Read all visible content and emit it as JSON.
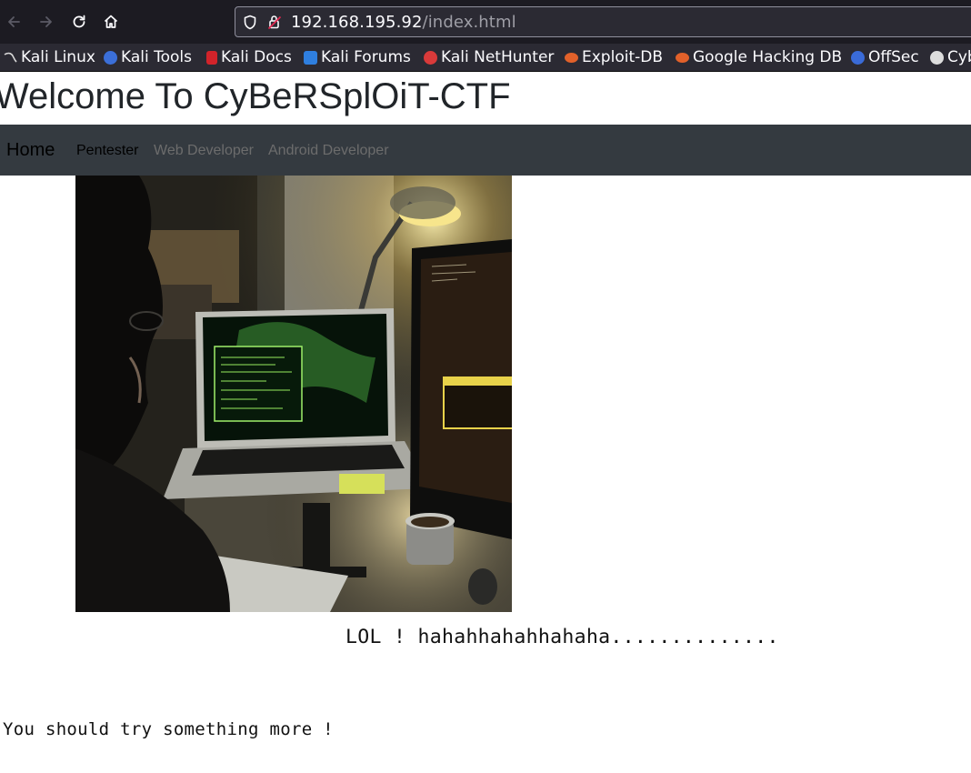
{
  "browser": {
    "url_host": "192.168.195.92",
    "url_path": "/index.html",
    "icons": [
      "back-arrow-icon",
      "forward-arrow-icon",
      "reload-icon",
      "home-icon",
      "shield-icon",
      "insecure-lock-icon"
    ]
  },
  "bookmarks": [
    {
      "label": "Kali Linux",
      "icon": "kali-dragon-icon",
      "color": "#111111"
    },
    {
      "label": "Kali Tools",
      "icon": "kali-tools-icon",
      "color": "#3b6fd9"
    },
    {
      "label": "Kali Docs",
      "icon": "kali-docs-icon",
      "color": "#d2232a"
    },
    {
      "label": "Kali Forums",
      "icon": "kali-forums-icon",
      "color": "#2f7fe0"
    },
    {
      "label": "Kali NetHunter",
      "icon": "nethunter-icon",
      "color": "#d93a3a"
    },
    {
      "label": "Exploit-DB",
      "icon": "exploit-db-icon",
      "color": "#e2612a"
    },
    {
      "label": "Google Hacking DB",
      "icon": "ghdb-icon",
      "color": "#e2612a"
    },
    {
      "label": "OffSec",
      "icon": "offsec-icon",
      "color": "#3a6bd8"
    },
    {
      "label": "Cyb",
      "icon": "cyberchef-icon",
      "color": "#dddddd"
    }
  ],
  "page": {
    "title": "Welcome To CyBeRSplOiT-CTF",
    "nav": {
      "brand": "Home",
      "links": [
        "Pentester",
        "Web Developer",
        "Android Developer"
      ]
    },
    "message": "LOL ! hahahhahahhahaha..............",
    "hint": "You should try something more !"
  },
  "colors": {
    "navbar_bg": "#343a40",
    "chrome_bg": "#1c1b22",
    "bookmarks_bg": "#2b2a33"
  }
}
